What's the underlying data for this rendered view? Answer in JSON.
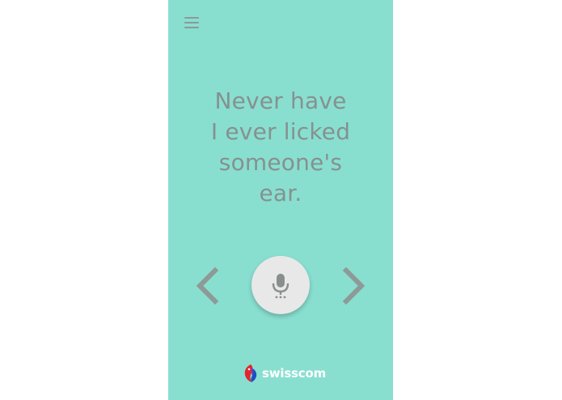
{
  "app": {
    "brand_name": "swisscom",
    "background_color": "#88dfd0",
    "text_color": "#86918f"
  },
  "header": {
    "menu_icon": "hamburger-menu-icon"
  },
  "question": {
    "lines": [
      "Never have",
      "I ever licked",
      "someone's",
      "ear."
    ]
  },
  "controls": {
    "prev_icon": "chevron-left-icon",
    "mic_icon": "microphone-icon",
    "next_icon": "chevron-right-icon",
    "mic_button_color": "#e8e8e8"
  },
  "footer": {
    "logo_icon": "swisscom-logo-icon"
  }
}
